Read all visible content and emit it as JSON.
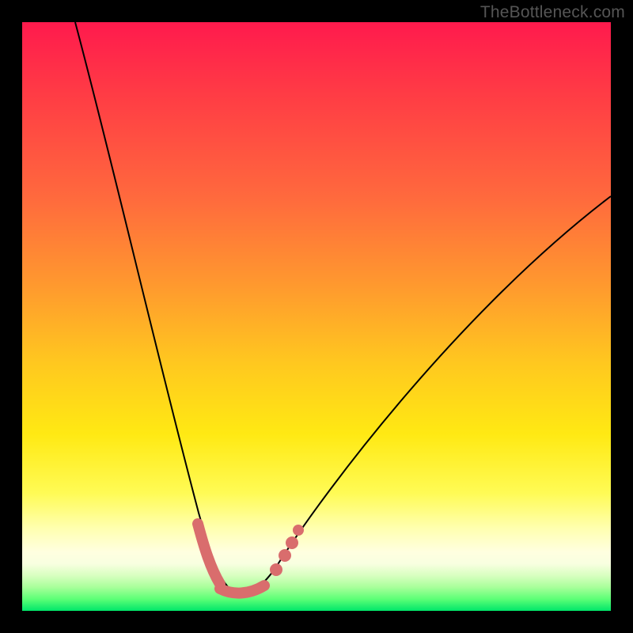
{
  "watermark": "TheBottleneck.com",
  "chart_data": {
    "type": "line",
    "title": "",
    "xlabel": "",
    "ylabel": "",
    "xlim": [
      0,
      100
    ],
    "ylim": [
      0,
      100
    ],
    "grid": false,
    "legend": false,
    "series": [
      {
        "name": "bottleneck-curve",
        "x": [
          9,
          12,
          15,
          18,
          21,
          24,
          27,
          30,
          33,
          34,
          36,
          38,
          40,
          42,
          45,
          50,
          55,
          60,
          65,
          70,
          75,
          80,
          85,
          90,
          95,
          100
        ],
        "y": [
          100,
          85,
          71,
          58,
          46,
          35,
          25,
          16,
          8,
          6,
          4,
          3,
          3,
          4,
          7,
          13,
          20,
          27,
          34,
          40,
          46,
          52,
          57,
          62,
          66,
          70
        ]
      }
    ],
    "highlighted_points": {
      "name": "marked-dots",
      "x": [
        30.5,
        31.5,
        32.5,
        33.5,
        36.0,
        38.5,
        41.0,
        42.5,
        44.0,
        45.0,
        46.5
      ],
      "y": [
        13,
        10,
        7,
        5,
        3,
        3,
        4,
        5,
        7,
        9,
        12
      ]
    },
    "background_gradient": {
      "top": "#ff1a4d",
      "mid": "#ffe913",
      "bottom": "#00e66a"
    }
  }
}
